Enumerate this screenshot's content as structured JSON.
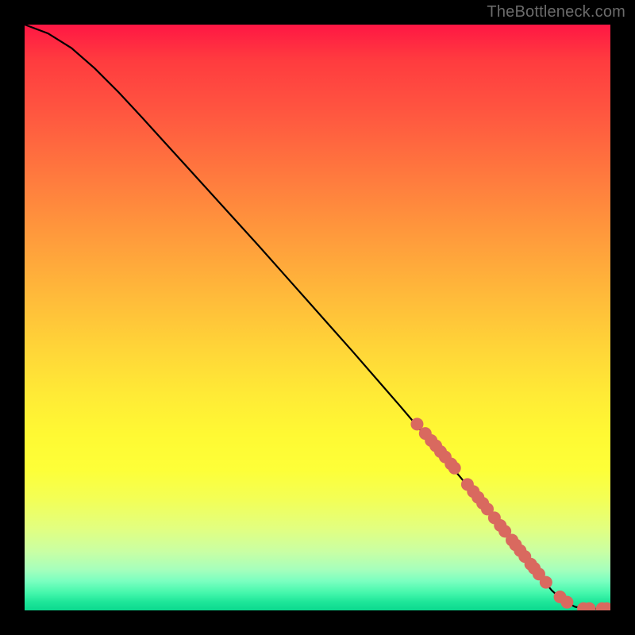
{
  "watermark": "TheBottleneck.com",
  "chart_data": {
    "type": "line",
    "title": "",
    "xlabel": "",
    "ylabel": "",
    "xlim": [
      0,
      100
    ],
    "ylim": [
      0,
      100
    ],
    "grid": false,
    "legend": false,
    "series": [
      {
        "name": "curve",
        "type": "line",
        "x": [
          0,
          4,
          8,
          12,
          16,
          20,
          24,
          28,
          32,
          36,
          40,
          44,
          48,
          52,
          56,
          60,
          64,
          68,
          72,
          76,
          80,
          84,
          86,
          88,
          90,
          92,
          94,
          96,
          98,
          100
        ],
        "y": [
          100,
          98.5,
          96,
          92.5,
          88.5,
          84.2,
          79.8,
          75.4,
          71.0,
          66.6,
          62.2,
          57.7,
          53.2,
          48.7,
          44.2,
          39.6,
          35.0,
          30.3,
          25.6,
          20.8,
          16.0,
          11.0,
          8.4,
          5.8,
          3.4,
          1.6,
          0.6,
          0.3,
          0.3,
          0.3
        ],
        "color": "#000000"
      },
      {
        "name": "markers",
        "type": "scatter",
        "x": [
          67.0,
          68.4,
          69.4,
          70.2,
          71.0,
          71.8,
          72.8,
          73.4,
          75.6,
          76.6,
          77.4,
          78.2,
          79.0,
          80.2,
          81.2,
          82.0,
          83.2,
          83.8,
          84.6,
          85.4,
          86.4,
          87.0,
          87.8,
          89.0,
          91.4,
          92.6,
          95.4,
          96.4,
          98.6,
          99.4
        ],
        "y": [
          31.8,
          30.2,
          29.0,
          28.1,
          27.1,
          26.2,
          25.0,
          24.3,
          21.5,
          20.3,
          19.3,
          18.3,
          17.3,
          15.8,
          14.5,
          13.5,
          12.0,
          11.2,
          10.2,
          9.2,
          7.9,
          7.2,
          6.2,
          4.8,
          2.3,
          1.4,
          0.3,
          0.3,
          0.3,
          0.3
        ],
        "color": "#d9695f",
        "radius": 8
      }
    ],
    "background_gradient": {
      "direction": "vertical",
      "stops": [
        {
          "pos": 0.0,
          "color": "#ff1744"
        },
        {
          "pos": 0.5,
          "color": "#ffd438"
        },
        {
          "pos": 0.75,
          "color": "#fdff38"
        },
        {
          "pos": 1.0,
          "color": "#0bd98e"
        }
      ]
    }
  }
}
